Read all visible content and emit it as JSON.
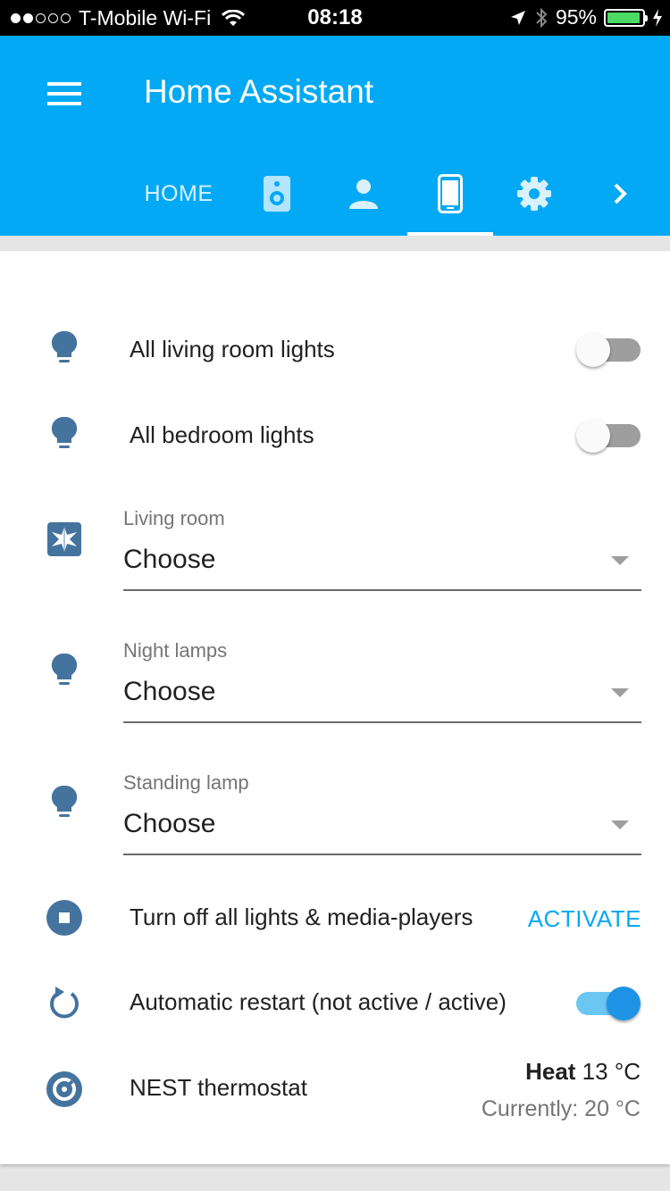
{
  "status_bar": {
    "carrier": "T-Mobile Wi-Fi",
    "time": "08:18",
    "battery": "95%",
    "signal_dots": [
      true,
      true,
      false,
      false,
      false
    ],
    "icons": [
      "wifi-icon",
      "location-arrow-icon",
      "bluetooth-icon",
      "battery-icon",
      "charging-bolt-icon"
    ],
    "battery_color": "#4cd964"
  },
  "header": {
    "title": "Home Assistant",
    "color": "#03a9f4",
    "tabs": [
      {
        "label": "HOME",
        "icon": null,
        "active": false
      },
      {
        "label": "",
        "icon": "speaker-icon",
        "active": false
      },
      {
        "label": "",
        "icon": "person-icon",
        "active": false
      },
      {
        "label": "",
        "icon": "cellphone-icon",
        "active": true
      },
      {
        "label": "",
        "icon": "gear-icon",
        "active": false
      },
      {
        "label": "",
        "icon": "chevron-right-icon",
        "active": false
      }
    ]
  },
  "card": {
    "rows": [
      {
        "type": "toggle",
        "icon": "lightbulb-icon",
        "label": "All living room lights",
        "on": false
      },
      {
        "type": "toggle",
        "icon": "lightbulb-icon",
        "label": "All bedroom lights",
        "on": false
      },
      {
        "type": "select",
        "icon": "scene-icon",
        "caption": "Living room",
        "value": "Choose"
      },
      {
        "type": "select",
        "icon": "lightbulb-icon",
        "caption": "Night lamps",
        "value": "Choose"
      },
      {
        "type": "select",
        "icon": "lightbulb-icon",
        "caption": "Standing lamp",
        "value": "Choose"
      },
      {
        "type": "script",
        "icon": "stop-circle-icon",
        "label": "Turn off all lights & media-players",
        "action": "ACTIVATE"
      },
      {
        "type": "toggle",
        "icon": "restart-icon",
        "label": "Automatic restart (not active / active)",
        "on": true
      },
      {
        "type": "climate",
        "icon": "nest-thermostat-icon",
        "label": "NEST thermostat",
        "mode": "Heat",
        "target": "13 °C",
        "current": "Currently: 20 °C"
      }
    ]
  },
  "colors": {
    "accent": "#03a9f4",
    "icon": "#44739e",
    "toggle_on": "#1e93e6"
  }
}
